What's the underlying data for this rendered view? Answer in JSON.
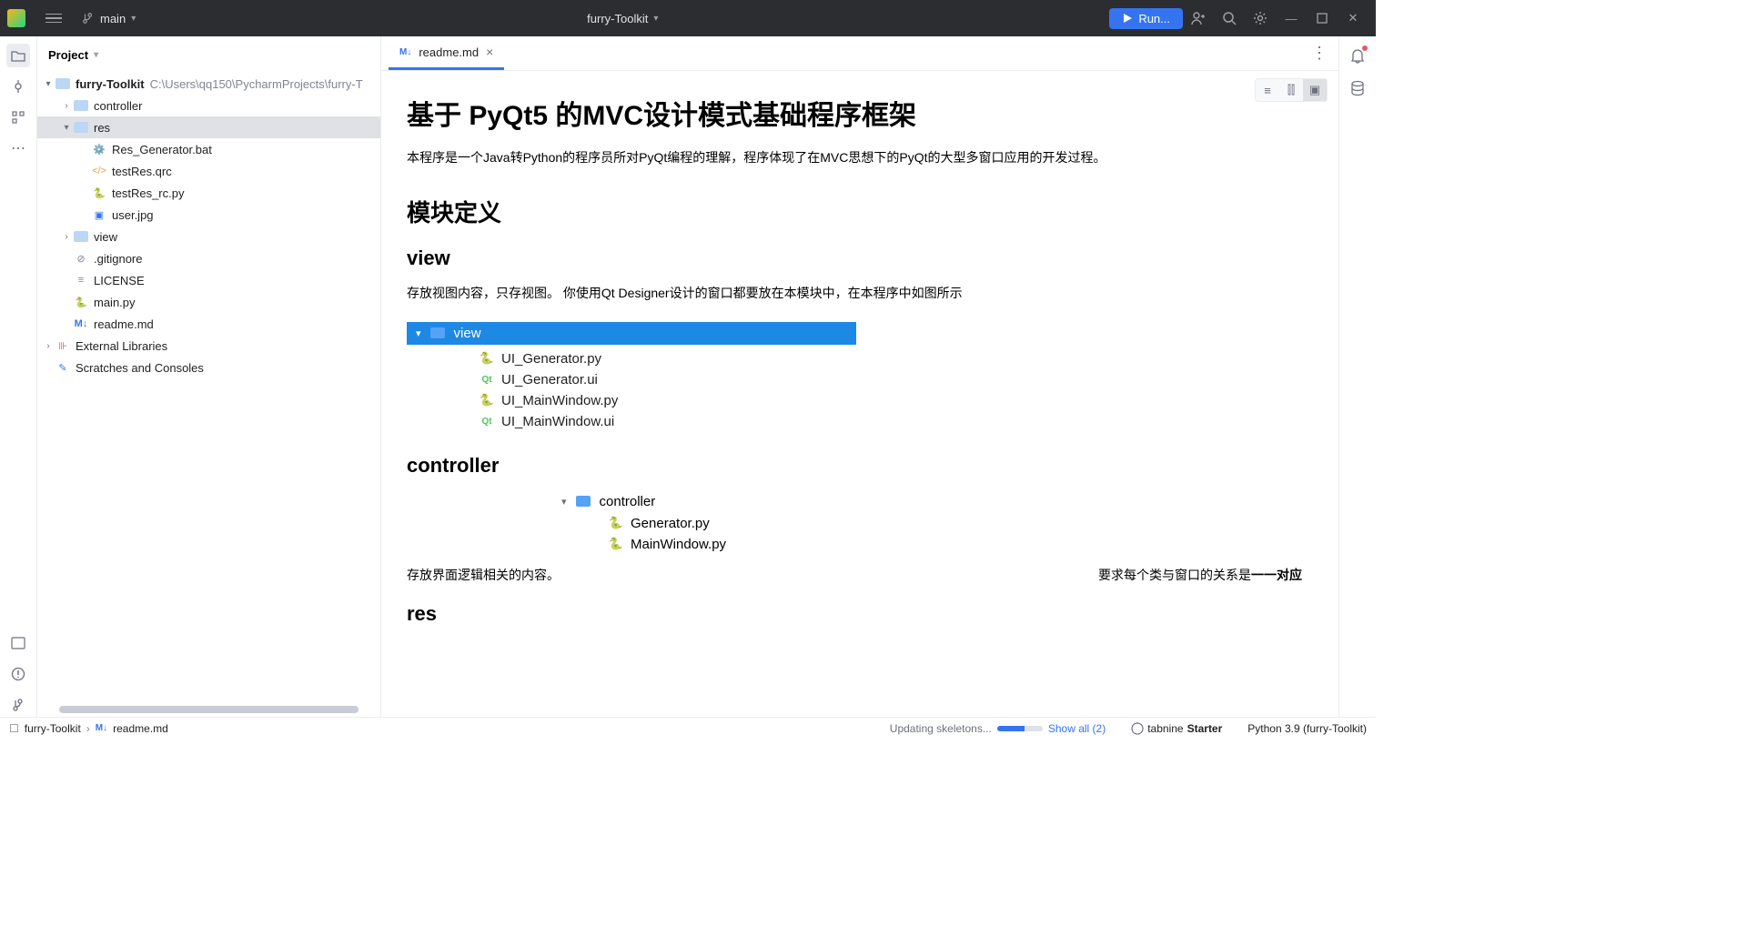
{
  "titlebar": {
    "branch": "main",
    "project": "furry-Toolkit",
    "run_label": "Run..."
  },
  "sidebar": {
    "header": "Project",
    "tree": {
      "root": {
        "name": "furry-Toolkit",
        "path": "C:\\Users\\qq150\\PycharmProjects\\furry-T"
      },
      "controller": "controller",
      "res": "res",
      "res_items": {
        "gen": "Res_Generator.bat",
        "qrc": "testRes.qrc",
        "rc": "testRes_rc.py",
        "user": "user.jpg"
      },
      "view": "view",
      "gitignore": ".gitignore",
      "license": "LICENSE",
      "mainpy": "main.py",
      "readme": "readme.md",
      "ext": "External Libraries",
      "scratch": "Scratches and Consoles"
    }
  },
  "tabs": {
    "readme": "readme.md"
  },
  "doc": {
    "h1": "基于 PyQt5 的MVC设计模式基础程序框架",
    "p1": "本程序是一个Java转Python的程序员所对PyQt编程的理解，程序体现了在MVC思想下的PyQt的大型多窗口应用的开发过程。",
    "h2_modules": "模块定义",
    "h3_view": "view",
    "p_view": "存放视图内容，只存视图。 你使用Qt Designer设计的窗口都要放在本模块中，在本程序中如图所示",
    "view_folder": "view",
    "view_items": {
      "a": "UI_Generator.py",
      "b": "UI_Generator.ui",
      "c": "UI_MainWindow.py",
      "d": "UI_MainWindow.ui"
    },
    "h3_controller": "controller",
    "controller_folder": "controller",
    "controller_items": {
      "a": "Generator.py",
      "b": "MainWindow.py"
    },
    "p_ctrl_left": "存放界面逻辑相关的内容。",
    "p_ctrl_right_pre": "要求每个类与窗口的关系是",
    "p_ctrl_right_bold": "一一对应",
    "h3_res": "res"
  },
  "statusbar": {
    "crumb_root": "furry-Toolkit",
    "crumb_file": "readme.md",
    "updating": "Updating skeletons...",
    "showall": "Show all (2)",
    "tabnine": "tabnine",
    "starter": "Starter",
    "interpreter": "Python 3.9 (furry-Toolkit)"
  }
}
